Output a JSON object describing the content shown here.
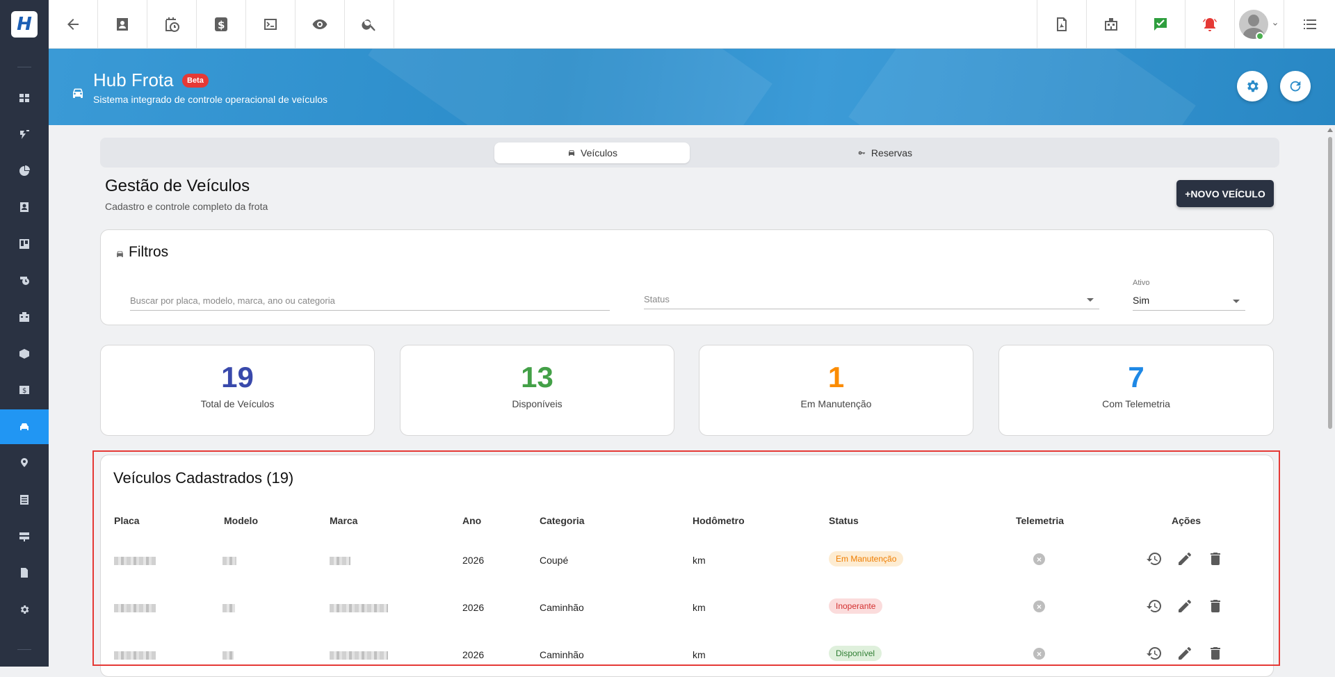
{
  "app": {
    "logo_text": "H"
  },
  "header": {
    "title": "Hub Frota",
    "beta_label": "Beta",
    "subtitle": "Sistema integrado de controle operacional de veículos"
  },
  "tabs": [
    {
      "label": "Veículos",
      "icon": "car-icon",
      "active": true
    },
    {
      "label": "Reservas",
      "icon": "key-icon",
      "active": false
    }
  ],
  "page": {
    "title": "Gestão de Veículos",
    "subtitle": "Cadastro e controle completo da frota",
    "new_button": "+NOVO VEÍCULO"
  },
  "filters": {
    "title": "Filtros",
    "search_placeholder": "Buscar por placa, modelo, marca, ano ou categoria",
    "status_placeholder": "Status",
    "ativo_label": "Ativo",
    "ativo_value": "Sim"
  },
  "stats": [
    {
      "value": "19",
      "label": "Total de Veículos",
      "color": "#3949ab"
    },
    {
      "value": "13",
      "label": "Disponíveis",
      "color": "#43a047"
    },
    {
      "value": "1",
      "label": "Em Manutenção",
      "color": "#fb8c00"
    },
    {
      "value": "7",
      "label": "Com Telemetria",
      "color": "#1e88e5"
    }
  ],
  "table": {
    "title": "Veículos Cadastrados (19)",
    "columns": [
      "Placa",
      "Modelo",
      "Marca",
      "Ano",
      "Categoria",
      "Hodômetro",
      "Status",
      "Telemetria",
      "Ações"
    ],
    "rows": [
      {
        "ano": "2026",
        "categoria": "Coupé",
        "hodometro": "km",
        "status": "Em Manutenção"
      },
      {
        "ano": "2026",
        "categoria": "Caminhão",
        "hodometro": "km",
        "status": "Inoperante"
      },
      {
        "ano": "2026",
        "categoria": "Caminhão",
        "hodometro": "km",
        "status": "Disponível"
      }
    ]
  },
  "status_colors": {
    "Em Manutenção": {
      "bg": "#fdecd2",
      "fg": "#ef7d00"
    },
    "Inoperante": {
      "bg": "#fbdcdc",
      "fg": "#d32f2f"
    },
    "Disponível": {
      "bg": "#dff0dc",
      "fg": "#2e7d32"
    }
  },
  "sidebar_icons": [
    "dashboard-icon",
    "tasks-icon",
    "chart-pie-icon",
    "contact-icon",
    "board-icon",
    "calendar-clock-icon",
    "building-icon",
    "box-icon",
    "finance-icon",
    "car-icon",
    "location-icon",
    "list-icon",
    "server-icon",
    "document-icon",
    "settings-icon"
  ],
  "topbar_icons": [
    "back-arrow-icon",
    "contact-card-icon",
    "calendar-clock-icon",
    "dollar-icon",
    "terminal-icon",
    "eye-icon",
    "search-icon",
    "pdf-icon",
    "building-icon",
    "task-done-icon",
    "alarm-icon",
    "menu-list-icon"
  ]
}
